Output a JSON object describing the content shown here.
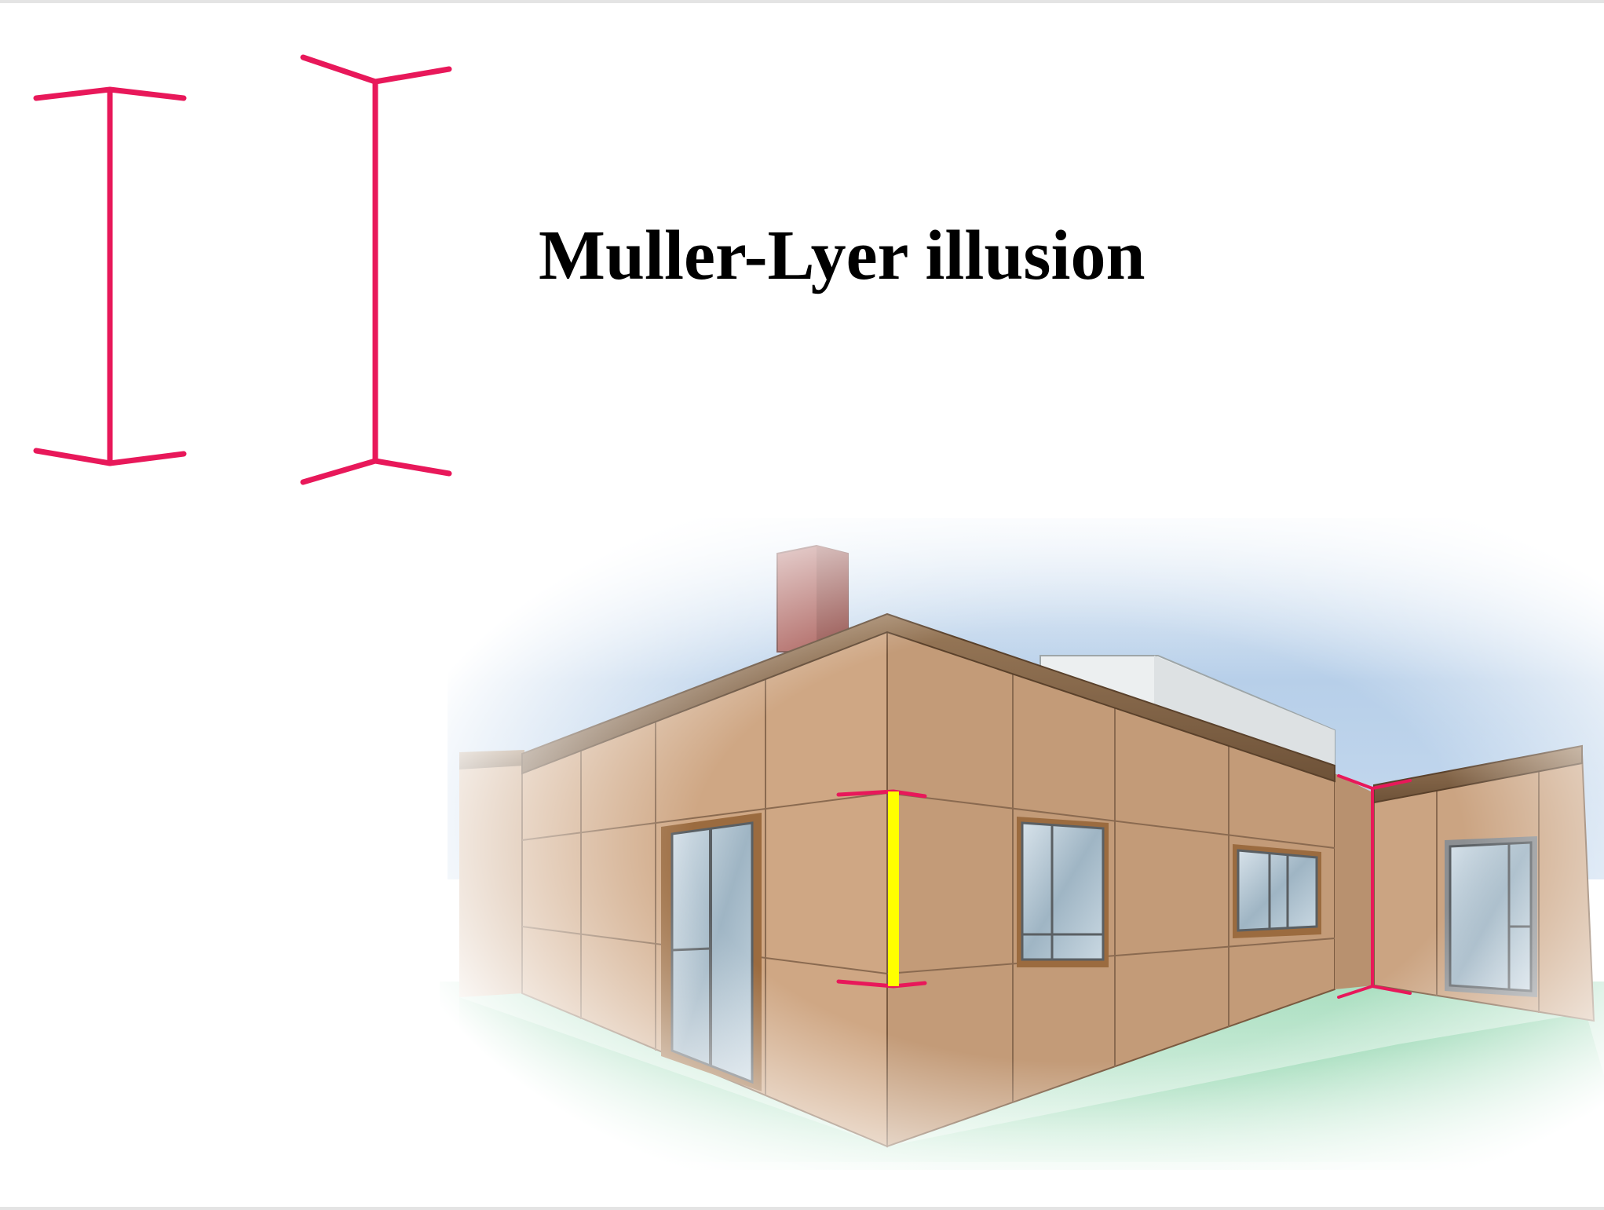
{
  "title": "Muller-Lyer illusion",
  "colors": {
    "arrow": "#e8185a",
    "highlight": "#ffff00",
    "wall": "#cfa784",
    "wall_dark": "#b88e6c",
    "roof_trim": "#8a6a4c",
    "chimney": "#a85a55",
    "sky": "#a9c6e6",
    "ground": "#7fcf9f",
    "glass": "#b6c8d4",
    "frame": "#9b6b3f"
  },
  "icons": {
    "figure_left": "inward-fins-line",
    "figure_right": "outward-fins-line",
    "building": "building-corner-illustration"
  }
}
